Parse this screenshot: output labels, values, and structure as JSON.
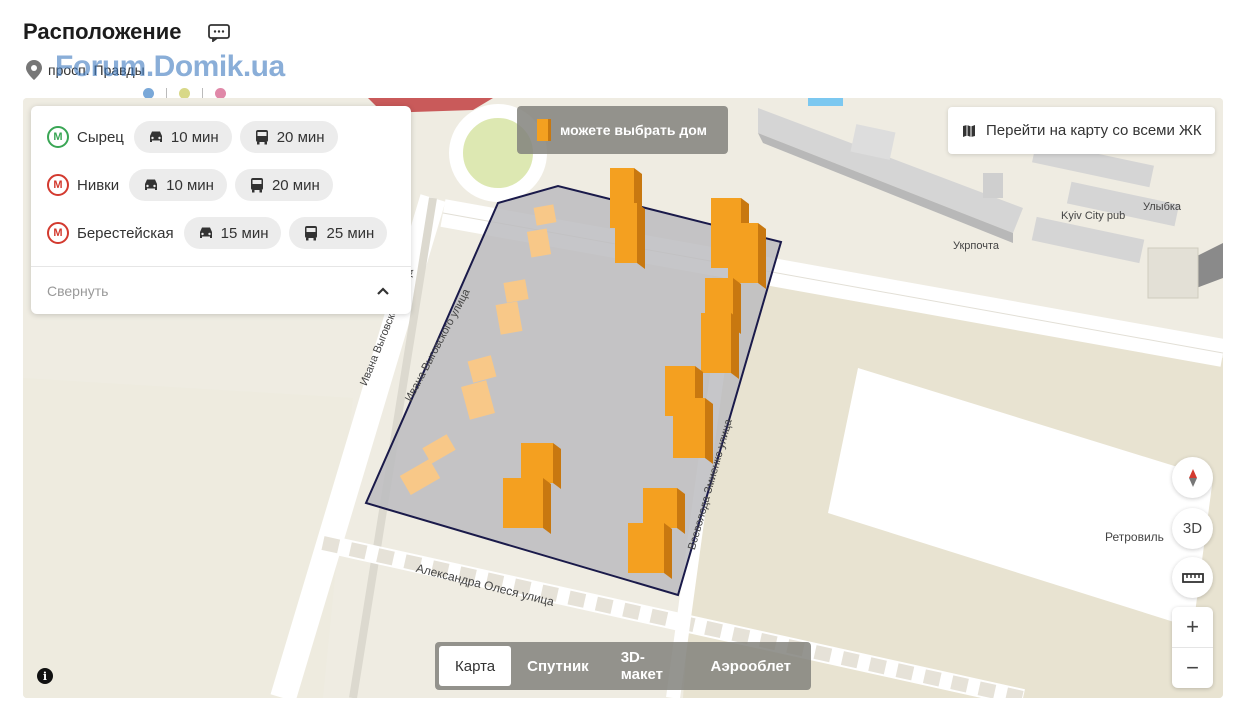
{
  "header": {
    "title": "Расположение",
    "address": "просп. Правды",
    "watermark": "Forum.Domik.ua"
  },
  "dot_colors": [
    "#7aa8d8",
    "#d8d888",
    "#e088a8"
  ],
  "transit": {
    "rows": [
      {
        "station": "Сырец",
        "metro_color": "#3aa655",
        "metro_letter": "М",
        "car_time": "10 мин",
        "bus_time": "20 мин"
      },
      {
        "station": "Нивки",
        "metro_color": "#d33a2f",
        "metro_letter": "М",
        "car_time": "10 мин",
        "bus_time": "20 мин"
      },
      {
        "station": "Берестейская",
        "metro_color": "#d33a2f",
        "metro_letter": "М",
        "car_time": "15 мин",
        "bus_time": "25 мин"
      }
    ],
    "collapse_label": "Свернуть"
  },
  "tip": {
    "label": "можете выбрать дом"
  },
  "all_map_button": {
    "label": "Перейти на карту со всеми ЖК"
  },
  "controls": {
    "three_d_label": "3D",
    "zoom_in": "+",
    "zoom_out": "−"
  },
  "map_modes": [
    {
      "label": "Карта",
      "active": true
    },
    {
      "label": "Спутник",
      "active": false
    },
    {
      "label": "3D-макет",
      "active": false
    },
    {
      "label": "Аэрооблет",
      "active": false
    }
  ],
  "map_labels": {
    "street_1": "Ивана Выговского улица",
    "street_2": "Ивана Выговского улица",
    "street_3": "Александра Олеся улица",
    "street_4": "Всеволода Змиенко улица",
    "poi_1": "Kyiv City pub",
    "poi_2": "Улыбка",
    "poi_3": "Укрпочта",
    "poi_4": "Ретровиль"
  },
  "colors": {
    "building": "#f4a020",
    "building_dark": "#c87810",
    "plot_outline": "#1a1a4a"
  }
}
